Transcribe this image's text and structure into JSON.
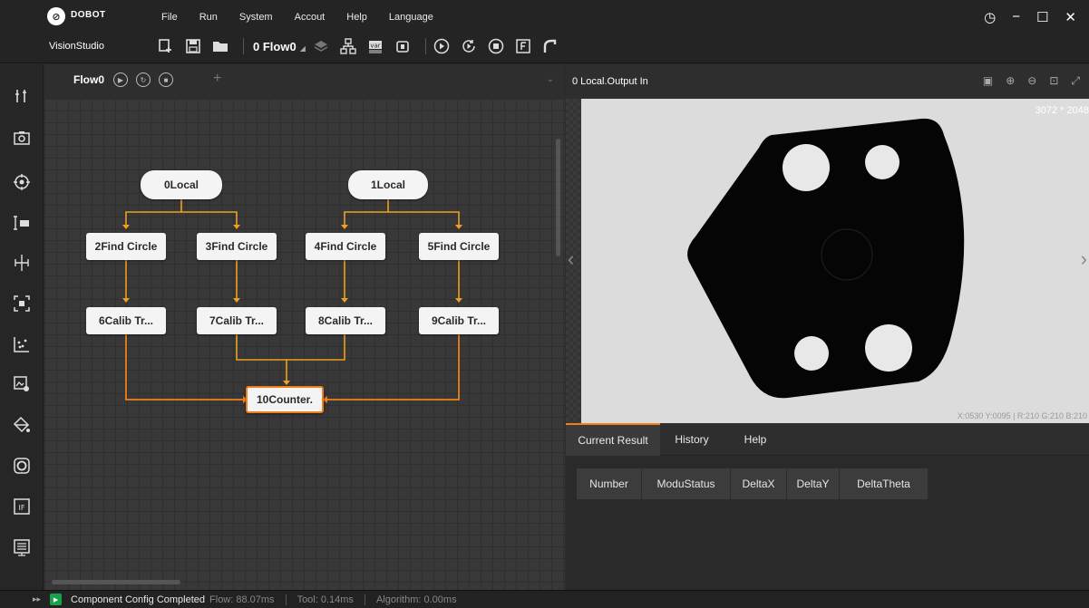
{
  "app": {
    "brand": "DOBOT",
    "product": "VisionStudio",
    "menu": [
      "File",
      "Run",
      "System",
      "Accout",
      "Help",
      "Language"
    ],
    "toolbar": {
      "flow_selector": "0 Flow0",
      "icons": [
        "add-module-icon",
        "save-icon",
        "open-folder-icon",
        "layers-icon",
        "network-icon",
        "variable-icon",
        "device-icon",
        "run-once-icon",
        "run-loop-icon",
        "stop-icon",
        "script-icon",
        "arm-icon"
      ]
    },
    "window_controls": [
      "settings-icon",
      "minimize-icon",
      "maximize-icon",
      "close-icon"
    ]
  },
  "rail": {
    "icons": [
      "tools-icon",
      "camera-icon",
      "target-icon",
      "measure-icon",
      "align-icon",
      "focus-icon",
      "scatter-icon",
      "image-settings-icon",
      "fill-icon",
      "ring-icon",
      "if-icon",
      "list-icon"
    ]
  },
  "flow": {
    "tab_label": "Flow0",
    "nodes": [
      {
        "id": "n0",
        "label": "0Local"
      },
      {
        "id": "n1",
        "label": "1Local"
      },
      {
        "id": "n2",
        "label": "2Find Circle"
      },
      {
        "id": "n3",
        "label": "3Find Circle"
      },
      {
        "id": "n4",
        "label": "4Find Circle"
      },
      {
        "id": "n5",
        "label": "5Find Circle"
      },
      {
        "id": "n6",
        "label": "6Calib Tr..."
      },
      {
        "id": "n7",
        "label": "7Calib Tr..."
      },
      {
        "id": "n8",
        "label": "8Calib Tr..."
      },
      {
        "id": "n9",
        "label": "9Calib Tr..."
      },
      {
        "id": "n10",
        "label": "10Counter."
      }
    ],
    "wire_color": "#f0a020",
    "selected_color": "#f07f1a"
  },
  "view": {
    "title": "0 Local.Output In",
    "resolution": "3072 * 2048",
    "pixel_info": "X:0530 Y:0095 | R:210 G:210 B:210"
  },
  "results": {
    "tabs": [
      "Current Result",
      "History",
      "Help"
    ],
    "active_tab": "Current Result",
    "columns": [
      "Number",
      "ModuStatus",
      "DeltaX",
      "DeltaY",
      "DeltaTheta"
    ]
  },
  "status": {
    "message": "Component Config Completed",
    "flow_time": "Flow: 88.07ms",
    "tool_time": "Tool: 0.14ms",
    "algorithm_time": "Algorithm: 0.00ms"
  },
  "colors": {
    "accent": "#f07f1a",
    "run_green": "#18a04a"
  }
}
